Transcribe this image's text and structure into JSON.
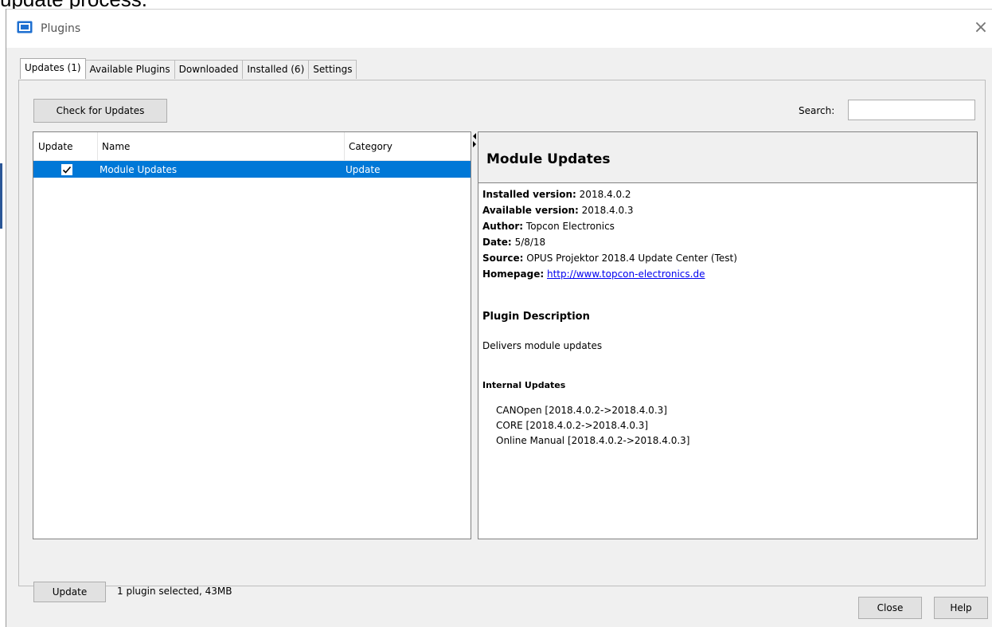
{
  "caption": "update process.",
  "window": {
    "title": "Plugins",
    "close_glyph": "×",
    "icon": "plugins-window-icon",
    "close_icon": "close-icon"
  },
  "tabs": [
    {
      "label": "Updates (1)",
      "active": true
    },
    {
      "label": "Available Plugins",
      "active": false
    },
    {
      "label": "Downloaded",
      "active": false
    },
    {
      "label": "Installed (6)",
      "active": false
    },
    {
      "label": "Settings",
      "active": false
    }
  ],
  "toolbar": {
    "check_updates_label": "Check for Updates",
    "search_label": "Search:",
    "search_value": ""
  },
  "table": {
    "columns": [
      "Update",
      "Name",
      "Category"
    ],
    "rows": [
      {
        "checked": true,
        "name": "Module Updates",
        "category": "Update",
        "selected": true
      }
    ]
  },
  "details": {
    "title": "Module Updates",
    "installed_label": "Installed version:",
    "installed_value": "2018.4.0.2",
    "available_label": "Available version:",
    "available_value": "2018.4.0.3",
    "author_label": "Author:",
    "author_value": "Topcon Electronics",
    "date_label": "Date:",
    "date_value": "5/8/18",
    "source_label": "Source:",
    "source_value": "OPUS Projektor 2018.4 Update Center (Test)",
    "homepage_label": "Homepage:",
    "homepage_value": "http://www.topcon-electronics.de",
    "description_heading": "Plugin Description",
    "description_text": "Delivers module updates",
    "internal_heading": "Internal Updates",
    "internal_updates": [
      "CANOpen [2018.4.0.2->2018.4.0.3]",
      "CORE [2018.4.0.2->2018.4.0.3]",
      "Online Manual [2018.4.0.2->2018.4.0.3]"
    ]
  },
  "footer": {
    "update_label": "Update",
    "status": "1 plugin selected, 43MB",
    "close_label": "Close",
    "help_label": "Help"
  },
  "colors": {
    "selection": "#0078d7",
    "link": "#0000ee",
    "window_bg": "#f0f0f0"
  }
}
